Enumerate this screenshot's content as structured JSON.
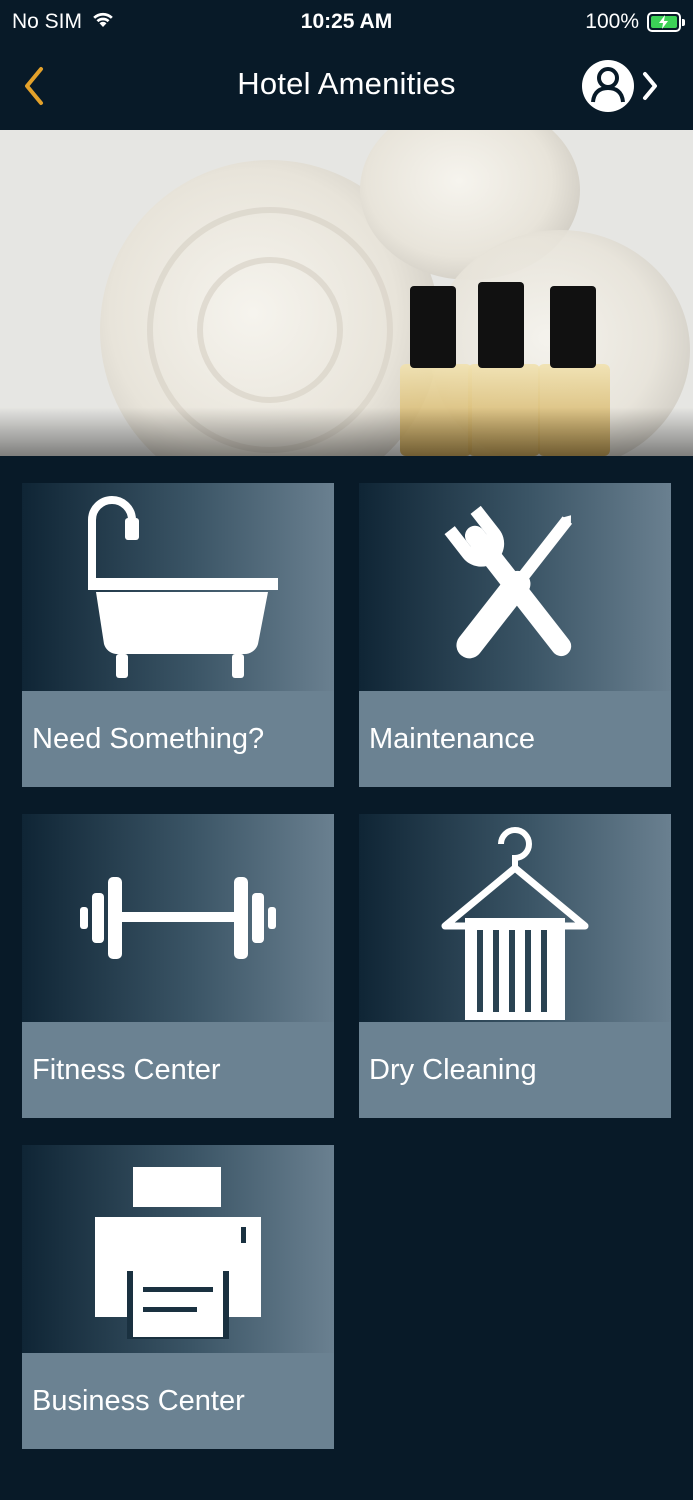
{
  "status_bar": {
    "carrier": "No SIM",
    "time": "10:25 AM",
    "battery_percent": "100%"
  },
  "nav": {
    "title": "Hotel Amenities"
  },
  "hero": {
    "image": "towels-and-toiletry-bottles"
  },
  "tiles": [
    {
      "label": "Need Something?",
      "icon": "bathtub-icon"
    },
    {
      "label": "Maintenance",
      "icon": "tools-icon"
    },
    {
      "label": "Fitness Center",
      "icon": "dumbbell-icon"
    },
    {
      "label": "Dry Cleaning",
      "icon": "hanger-icon"
    },
    {
      "label": "Business Center",
      "icon": "printer-icon"
    }
  ],
  "colors": {
    "background": "#081a28",
    "accent": "#e3a12a",
    "tile_label_bg": "#6b8292",
    "battery_green": "#3cd157"
  }
}
